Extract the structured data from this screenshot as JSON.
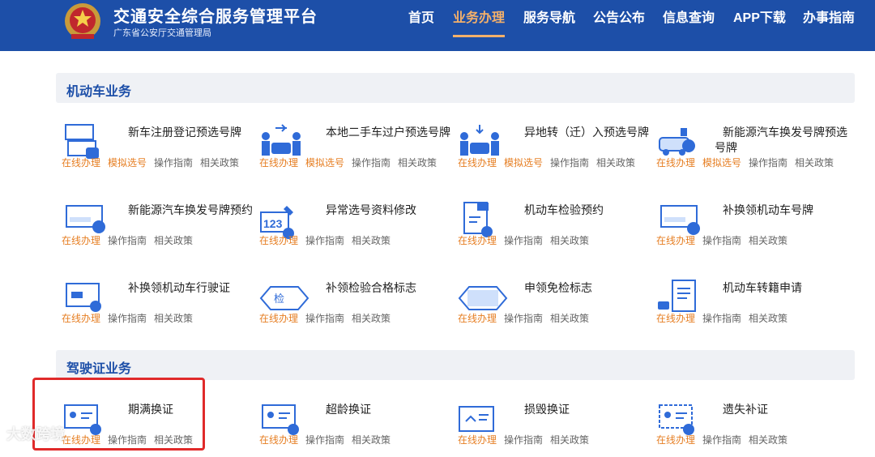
{
  "header": {
    "title": "交通安全综合服务管理平台",
    "subtitle": "广东省公安厅交通管理局",
    "nav": [
      "首页",
      "业务办理",
      "服务导航",
      "公告公布",
      "信息查询",
      "APP下载",
      "办事指南"
    ],
    "active_nav": "业务办理",
    "colors": {
      "bar": "#1d4fa8",
      "accent": "#f4b06a"
    }
  },
  "sections": {
    "vehicle": "机动车业务",
    "license": "驾驶证业务"
  },
  "links": {
    "online": "在线办理",
    "simulate": "模拟选号",
    "guide": "操作指南",
    "policy": "相关政策"
  },
  "vehicle_cards": [
    {
      "name": "新车注册登记预选号牌",
      "icon": "plate-select-icon",
      "simulate": true
    },
    {
      "name": "本地二手车过户预选号牌",
      "icon": "car-transfer-icon",
      "simulate": true
    },
    {
      "name": "异地转（迁）入预选号牌",
      "icon": "car-relocate-icon",
      "simulate": true
    },
    {
      "name": "新能源汽车换发号牌预选号牌",
      "icon": "ev-car-icon",
      "simulate": true
    },
    {
      "name": "新能源汽车换发号牌预约",
      "icon": "plate-reserve-icon",
      "simulate": false
    },
    {
      "name": "异常选号资料修改",
      "icon": "number-edit-icon",
      "simulate": false
    },
    {
      "name": "机动车检验预约",
      "icon": "inspection-doc-icon",
      "simulate": false
    },
    {
      "name": "补换领机动车号牌",
      "icon": "plate-replace-icon",
      "simulate": false
    },
    {
      "name": "补换领机动车行驶证",
      "icon": "vehicle-license-icon",
      "simulate": false
    },
    {
      "name": "补领检验合格标志",
      "icon": "inspection-tag-icon",
      "simulate": false
    },
    {
      "name": "申领免检标志",
      "icon": "exempt-tag-icon",
      "simulate": false
    },
    {
      "name": "机动车转籍申请",
      "icon": "transfer-doc-icon",
      "simulate": false
    }
  ],
  "license_cards": [
    {
      "name": "期满换证",
      "icon": "license-expire-icon"
    },
    {
      "name": "超龄换证",
      "icon": "license-age-icon"
    },
    {
      "name": "损毁换证",
      "icon": "license-damaged-icon"
    },
    {
      "name": "遗失补证",
      "icon": "license-lost-icon"
    }
  ],
  "watermark": "大数跨境"
}
